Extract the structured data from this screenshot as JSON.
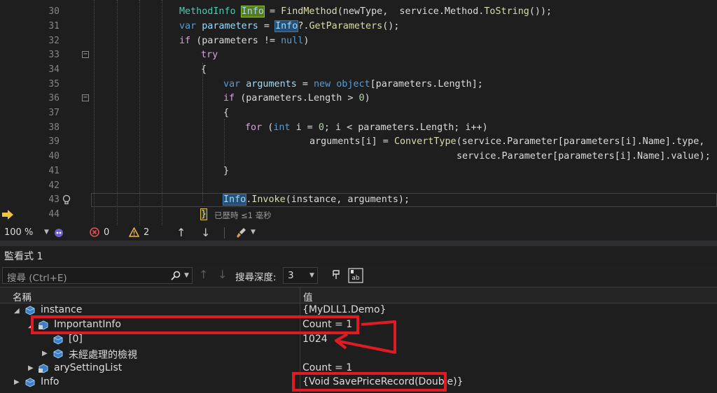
{
  "editor": {
    "lines": [
      {
        "num": "30"
      },
      {
        "num": "31"
      },
      {
        "num": "32"
      },
      {
        "num": "33"
      },
      {
        "num": "34"
      },
      {
        "num": "35"
      },
      {
        "num": "36"
      },
      {
        "num": "37"
      },
      {
        "num": "38"
      },
      {
        "num": "39"
      },
      {
        "num": "40"
      },
      {
        "num": "41"
      },
      {
        "num": "42"
      },
      {
        "num": "43"
      },
      {
        "num": "44"
      }
    ],
    "code": {
      "l30a": "MethodInfo ",
      "l30b": "Info",
      "l30c": " = ",
      "l30d": "FindMethod",
      "l30e": "(newType,  service.Method.",
      "l30f": "ToString",
      "l30g": "());",
      "l31a": "var ",
      "l31b": "parameters",
      "l31c": " = ",
      "l31d": "Info",
      "l31e": "?.",
      "l31f": "GetParameters",
      "l31g": "();",
      "l32a": "if ",
      "l32b": "(parameters != ",
      "l32c": "null",
      "l32d": ")",
      "l33a": "try",
      "l34a": "{",
      "l35a": "var ",
      "l35b": "arguments",
      "l35c": " = ",
      "l35d": "new ",
      "l35e": "object",
      "l35f": "[parameters.Length];",
      "l36a": "if ",
      "l36b": "(parameters.Length > ",
      "l36c": "0",
      "l36d": ")",
      "l37a": "{",
      "l38a": "for ",
      "l38b": "(",
      "l38c": "int ",
      "l38d": "i = ",
      "l38e": "0",
      "l38f": "; i < parameters.Length; i++)",
      "l39a": "arguments[i] = ",
      "l39b": "ConvertType",
      "l39c": "(service.Parameter[parameters[i].Name].type,",
      "l40a": "service.Parameter[parameters[i].Name].value);",
      "l41a": "}",
      "l43a": "Info",
      ".": ".",
      "l43b": "Invoke",
      "l43c": "(instance, arguments);",
      "l44a": "}",
      "l44b": "已歷時 ≤1 毫秒"
    }
  },
  "statusbar": {
    "zoom": "100 %",
    "errors": "0",
    "warnings": "2"
  },
  "watch": {
    "title": "監看式 1",
    "search_placeholder": "搜尋 (Ctrl+E)",
    "search_depth_label": "搜尋深度:",
    "search_depth_value": "3",
    "col_name": "名稱",
    "col_value": "值",
    "rows": [
      {
        "name": "instance",
        "value": "{MyDLL1.Demo}"
      },
      {
        "name": "ImportantInfo",
        "value": "Count = 1"
      },
      {
        "name": "[0]",
        "value": "1024"
      },
      {
        "name": "未經處理的檢視",
        "value": ""
      },
      {
        "name": "arySettingList",
        "value": "Count = 1"
      },
      {
        "name": "Info",
        "value": "{Void SavePriceRecord(Double)}"
      }
    ]
  },
  "colors": {
    "annotation_red": "#e01b24",
    "code_blue": "#569cd6",
    "type_teal": "#4ec9b0"
  }
}
